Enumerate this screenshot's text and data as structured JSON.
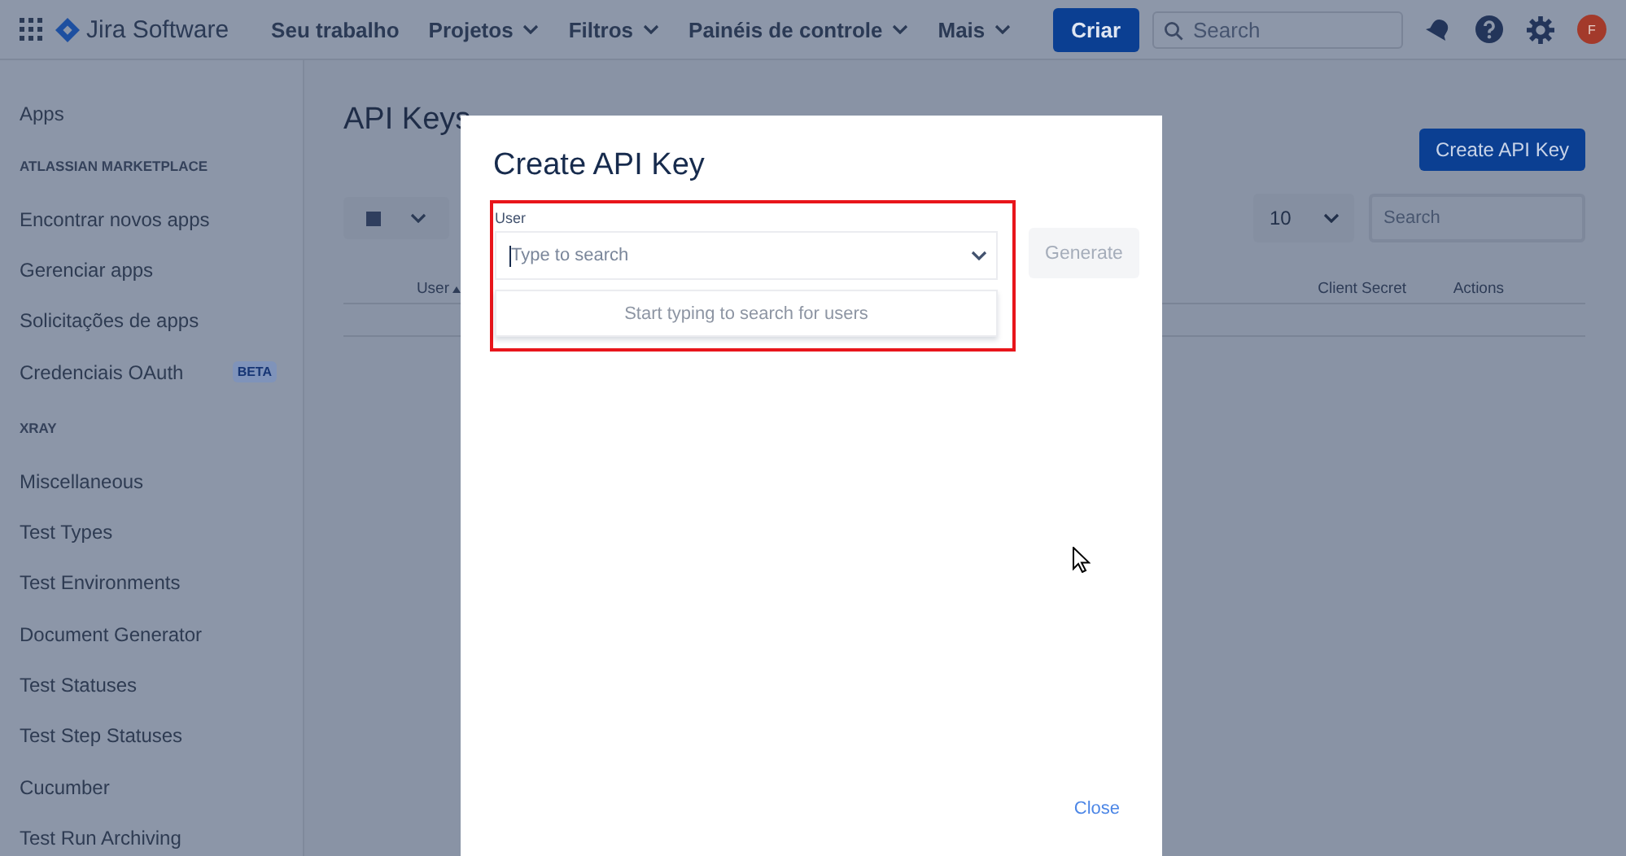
{
  "header": {
    "product": "Jira Software",
    "nav": [
      {
        "label": "Seu trabalho",
        "dropdown": false
      },
      {
        "label": "Projetos",
        "dropdown": true
      },
      {
        "label": "Filtros",
        "dropdown": true
      },
      {
        "label": "Painéis de controle",
        "dropdown": true
      },
      {
        "label": "Mais",
        "dropdown": true
      }
    ],
    "create_button": "Criar",
    "search": {
      "placeholder": "Search"
    },
    "avatar": "F"
  },
  "sidebar": {
    "title": "Apps",
    "sections": [
      {
        "heading": "ATLASSIAN MARKETPLACE",
        "items": [
          {
            "label": "Encontrar novos apps"
          },
          {
            "label": "Gerenciar apps"
          },
          {
            "label": "Solicitações de apps"
          },
          {
            "label": "Credenciais OAuth",
            "badge": "BETA"
          }
        ]
      },
      {
        "heading": "XRAY",
        "items": [
          {
            "label": "Miscellaneous"
          },
          {
            "label": "Test Types"
          },
          {
            "label": "Test Environments"
          },
          {
            "label": "Document Generator"
          },
          {
            "label": "Test Statuses"
          },
          {
            "label": "Test Step Statuses"
          },
          {
            "label": "Cucumber"
          },
          {
            "label": "Test Run Archiving"
          }
        ]
      }
    ]
  },
  "page": {
    "title": "API Keys",
    "create_button": "Create API Key",
    "page_size": "10",
    "search": {
      "placeholder": "Search"
    },
    "columns": [
      {
        "label": "User",
        "sortable": true
      },
      {
        "label": "Client Secret",
        "sortable": false
      },
      {
        "label": "Actions",
        "sortable": false
      }
    ]
  },
  "modal": {
    "title": "Create API Key",
    "field": {
      "label": "User",
      "placeholder": "Type to search"
    },
    "generate_button": {
      "label": "Generate",
      "disabled": true
    },
    "dropdown_message": "Start typing to search for users",
    "close": "Close"
  }
}
